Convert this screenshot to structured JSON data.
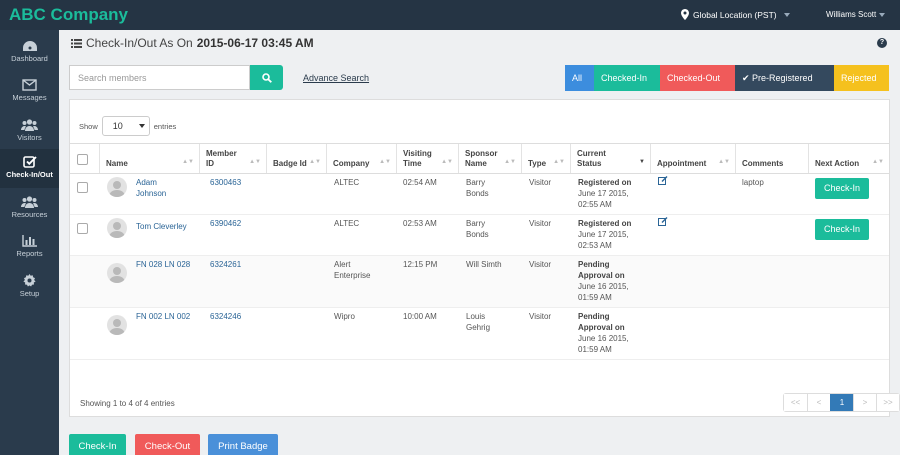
{
  "app": {
    "brand": "ABC Company",
    "location": "Global Location (PST)",
    "user": "Williams Scott"
  },
  "sidebar": {
    "items": [
      {
        "label": "Dashboard",
        "icon": "dashboard-icon"
      },
      {
        "label": "Messages",
        "icon": "envelope-icon"
      },
      {
        "label": "Visitors",
        "icon": "users-icon"
      },
      {
        "label": "Check-In/Out",
        "icon": "check-square-icon",
        "active": true
      },
      {
        "label": "Resources",
        "icon": "users-icon"
      },
      {
        "label": "Reports",
        "icon": "bar-chart-icon"
      },
      {
        "label": "Setup",
        "icon": "gear-icon"
      }
    ]
  },
  "page": {
    "title_prefix": "Check-In/Out As On",
    "title_date": "2015-06-17 03:45 AM",
    "help": "?"
  },
  "search": {
    "placeholder": "Search members",
    "advanced": "Advance Search"
  },
  "filters": [
    {
      "label": "All",
      "color": "#3c8dde"
    },
    {
      "label": "Checked-In",
      "color": "#1bbc9b"
    },
    {
      "label": "Checked-Out",
      "color": "#f05a5a"
    },
    {
      "label": "Pre-Registered",
      "color": "#34495e",
      "checked": true
    },
    {
      "label": "Rejected",
      "color": "#f5c11e"
    }
  ],
  "table": {
    "show_label": "Show",
    "entries_label": "entries",
    "page_length": "10",
    "columns": [
      "Name",
      "Member ID",
      "Badge Id",
      "Company",
      "Visiting Time",
      "Sponsor Name",
      "Type",
      "Current Status",
      "Appointment",
      "Comments",
      "Next Action"
    ],
    "rows": [
      {
        "name": "Adam Johnson",
        "member_id": "6300463",
        "badge_id": "",
        "company": "ALTEC",
        "time": "02:54 AM",
        "sponsor": "Barry Bonds",
        "type": "Visitor",
        "status_bold": "Registered on",
        "status_rest": "June 17 2015, 02:55 AM",
        "appointment": "edit-icon",
        "comments": "laptop",
        "action": "Check-In"
      },
      {
        "name": "Tom Cleverley",
        "member_id": "6390462",
        "badge_id": "",
        "company": "ALTEC",
        "time": "02:53 AM",
        "sponsor": "Barry Bonds",
        "type": "Visitor",
        "status_bold": "Registered on",
        "status_rest": "June 17 2015, 02:53 AM",
        "appointment": "edit-icon",
        "comments": "",
        "action": "Check-In"
      },
      {
        "name": "FN 028 LN 028",
        "member_id": "6324261",
        "badge_id": "",
        "company": "Alert Enterprise",
        "time": "12:15 PM",
        "sponsor": "Will Simth",
        "type": "Visitor",
        "status_bold": "Pending Approval on",
        "status_rest": "June 16 2015, 01:59 AM",
        "appointment": "",
        "comments": "",
        "action": ""
      },
      {
        "name": "FN 002 LN 002",
        "member_id": "6324246",
        "badge_id": "",
        "company": "Wipro",
        "time": "10:00 AM",
        "sponsor": "Louis Gehrig",
        "type": "Visitor",
        "status_bold": "Pending Approval on",
        "status_rest": "June 16 2015, 01:59 AM",
        "appointment": "",
        "comments": "",
        "action": ""
      }
    ],
    "info": "Showing 1 to 4 of 4 entries",
    "pager": [
      "<<",
      "<",
      "1",
      ">",
      ">>"
    ],
    "current_page": "1"
  },
  "actions": [
    {
      "label": "Check-In",
      "color": "#1bbc9b"
    },
    {
      "label": "Check-Out",
      "color": "#f05a5a"
    },
    {
      "label": "Print Badge",
      "color": "#4a90d9"
    }
  ]
}
